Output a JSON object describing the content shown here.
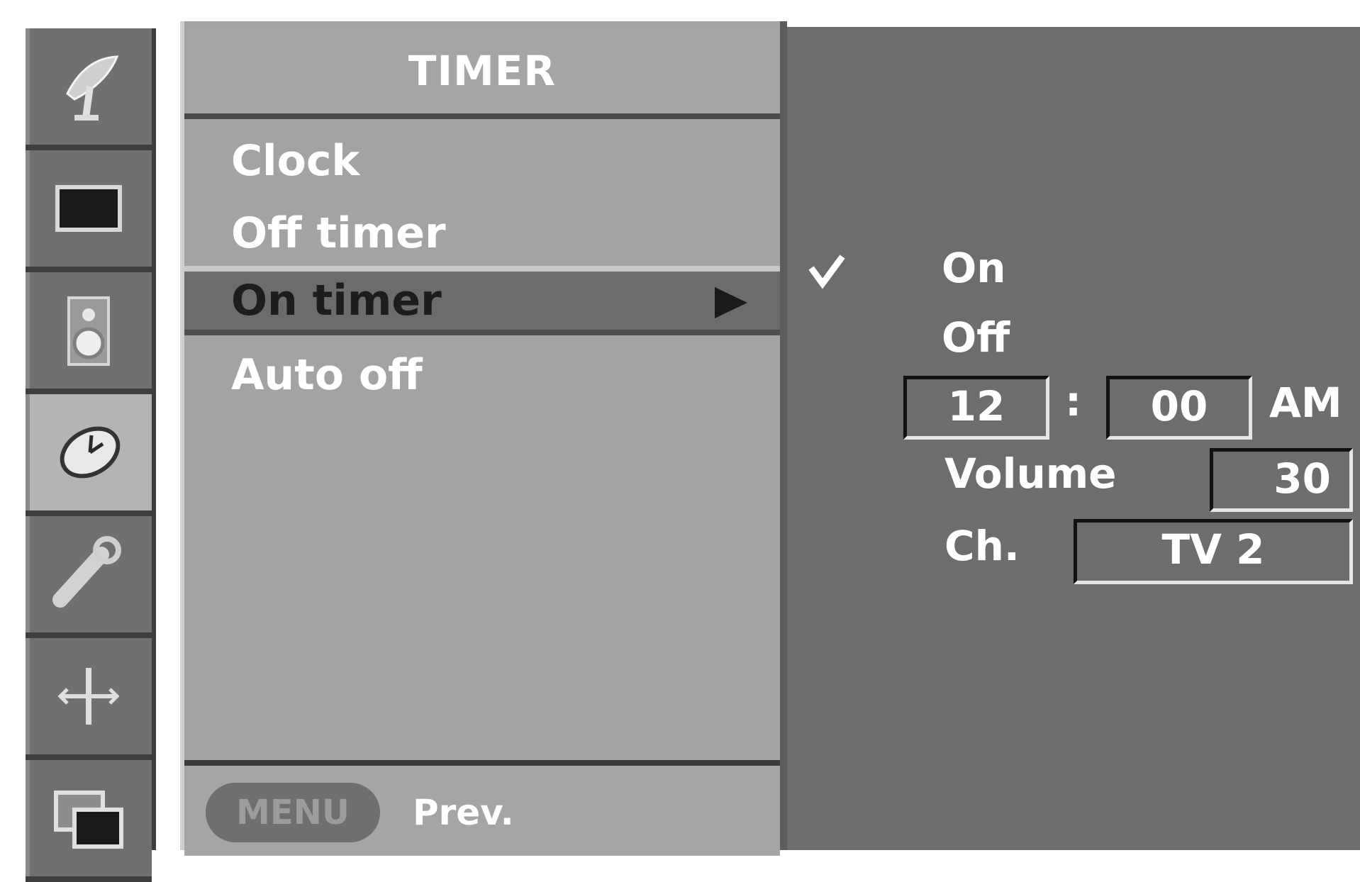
{
  "sidebar": {
    "icons": [
      {
        "name": "antenna-icon",
        "active": false
      },
      {
        "name": "picture-icon",
        "active": false
      },
      {
        "name": "speaker-icon",
        "active": false
      },
      {
        "name": "clock-icon",
        "active": true
      },
      {
        "name": "wrench-icon",
        "active": false
      },
      {
        "name": "screen-adjust-icon",
        "active": false
      },
      {
        "name": "pip-icon",
        "active": false
      }
    ]
  },
  "menu": {
    "title": "TIMER",
    "items": [
      {
        "label": "Clock",
        "selected": false
      },
      {
        "label": "Off timer",
        "selected": false
      },
      {
        "label": "On timer",
        "selected": true
      },
      {
        "label": "Auto off",
        "selected": false
      }
    ],
    "footer": {
      "button_label": "MENU",
      "hint_label": "Prev."
    }
  },
  "submenu": {
    "options": [
      {
        "label": "On",
        "checked": true
      },
      {
        "label": "Off",
        "checked": false
      }
    ],
    "time": {
      "hour": "12",
      "separator": ":",
      "minute": "00",
      "period": "AM"
    },
    "volume": {
      "label": "Volume",
      "value": "30"
    },
    "channel": {
      "label": "Ch.",
      "value": "TV 2"
    }
  },
  "colors": {
    "page_background": "#ffffff",
    "menu_panel": "#a3a3a3",
    "selected_item": "#6c6c6c",
    "submenu_panel": "#6d6d6d",
    "active_icon_cell": "#b4b4b4"
  }
}
